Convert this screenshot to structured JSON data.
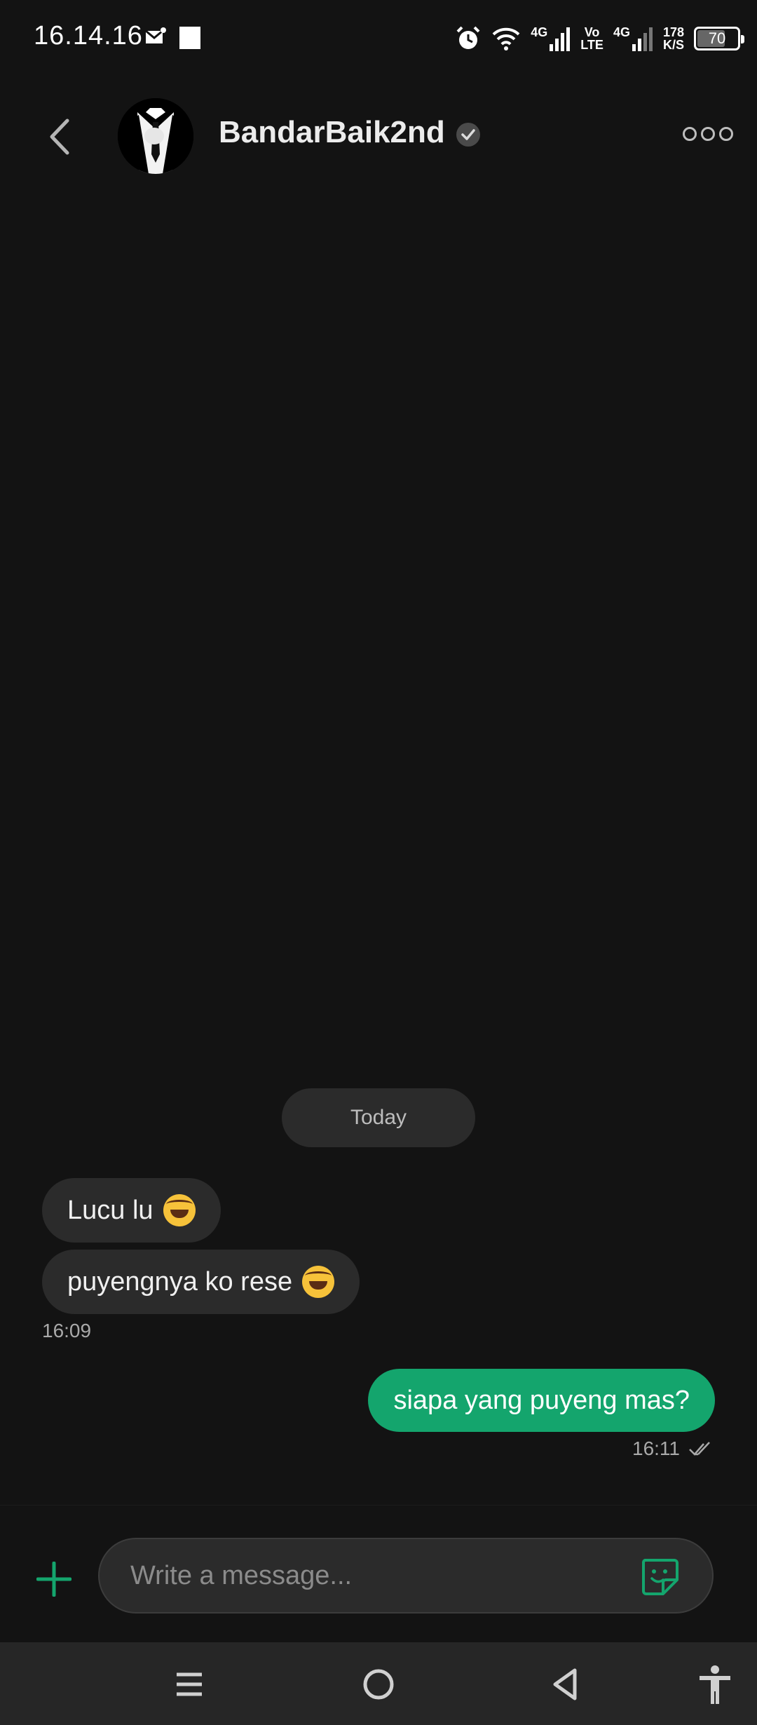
{
  "status_bar": {
    "time": "16.14.16",
    "network_1": "4G",
    "volte_top": "Vo",
    "volte_bottom": "LTE",
    "network_2": "4G",
    "speed_value": "178",
    "speed_unit": "K/S",
    "battery": "70",
    "battery_level": 0.7
  },
  "header": {
    "contact_name": "BandarBaik2nd"
  },
  "chat": {
    "date_divider": "Today",
    "messages_in": [
      {
        "text": "Lucu lu",
        "emoji": "rolling-on-floor-laughing"
      },
      {
        "text": "puyengnya ko rese",
        "emoji": "rolling-on-floor-laughing"
      }
    ],
    "time_in": "16:09",
    "message_out": {
      "text": "siapa yang puyeng mas?"
    },
    "time_out": "16:11",
    "read_status": "double-check"
  },
  "composer": {
    "placeholder": "Write a message..."
  },
  "colors": {
    "background": "#131313",
    "bubble_in": "#2b2b2b",
    "bubble_out": "#14a56d",
    "accent": "#14a56d"
  }
}
